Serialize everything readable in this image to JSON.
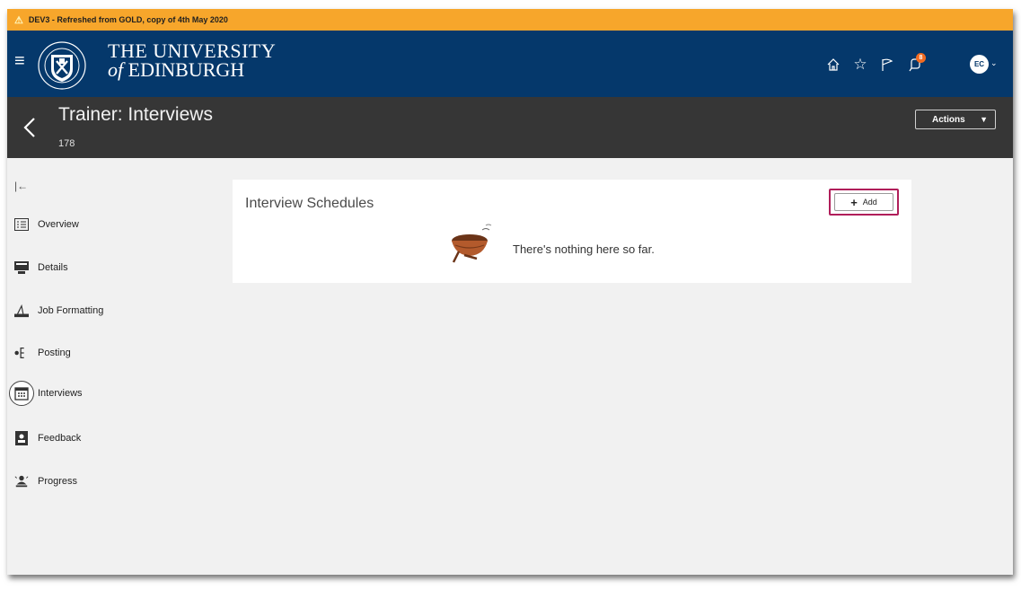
{
  "banner": {
    "text": "DEV3 - Refreshed from GOLD, copy of 4th May 2020",
    "icon": "warning-icon"
  },
  "header": {
    "brand_line1": "THE UNIVERSITY",
    "brand_of": "of",
    "brand_line2": "EDINBURGH",
    "icons": [
      "home-icon",
      "favorite-star-icon",
      "flag-icon",
      "notifications-icon"
    ],
    "notification_count": "8",
    "avatar_initials": "EC",
    "colors": {
      "header_bg": "#05386b",
      "banner_bg": "#f7a62b",
      "notif_badge": "#f26b21"
    }
  },
  "titlebar": {
    "title": "Trainer: Interviews",
    "subtitle": "178",
    "actions_label": "Actions"
  },
  "sidebar": {
    "items": [
      {
        "label": "Overview",
        "icon": "overview-list-icon"
      },
      {
        "label": "Details",
        "icon": "details-icon"
      },
      {
        "label": "Job Formatting",
        "icon": "job-formatting-icon"
      },
      {
        "label": "Posting",
        "icon": "posting-icon"
      },
      {
        "label": "Interviews",
        "icon": "calendar-icon",
        "active": true
      },
      {
        "label": "Feedback",
        "icon": "feedback-icon"
      },
      {
        "label": "Progress",
        "icon": "progress-icon"
      }
    ]
  },
  "panel": {
    "title": "Interview Schedules",
    "add_label": "Add",
    "empty_message": "There's nothing here so far.",
    "highlight_color": "#b01e5a"
  }
}
